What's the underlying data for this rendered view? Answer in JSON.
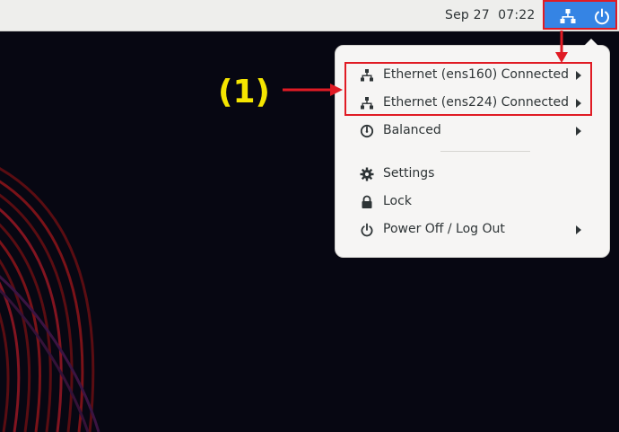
{
  "topbar": {
    "clock": "Sep 27  07:22",
    "tray_icons": [
      "network-icon",
      "power-icon"
    ]
  },
  "menu": {
    "items": [
      {
        "label": "Ethernet (ens160) Connected",
        "icon": "network-wired-icon",
        "submenu": true
      },
      {
        "label": "Ethernet (ens224) Connected",
        "icon": "network-wired-icon",
        "submenu": true
      },
      {
        "label": "Balanced",
        "icon": "power-profile-icon",
        "submenu": true
      },
      {
        "label": "Settings",
        "icon": "gear-icon",
        "submenu": false
      },
      {
        "label": "Lock",
        "icon": "lock-icon",
        "submenu": false
      },
      {
        "label": "Power Off / Log Out",
        "icon": "power-icon",
        "submenu": true
      }
    ]
  },
  "annotation": {
    "label": "(1)",
    "color": "#f5e500",
    "highlight_color": "#e01b24"
  },
  "colors": {
    "tray_accent": "#3584e4",
    "desktop_bg": "#070712"
  }
}
